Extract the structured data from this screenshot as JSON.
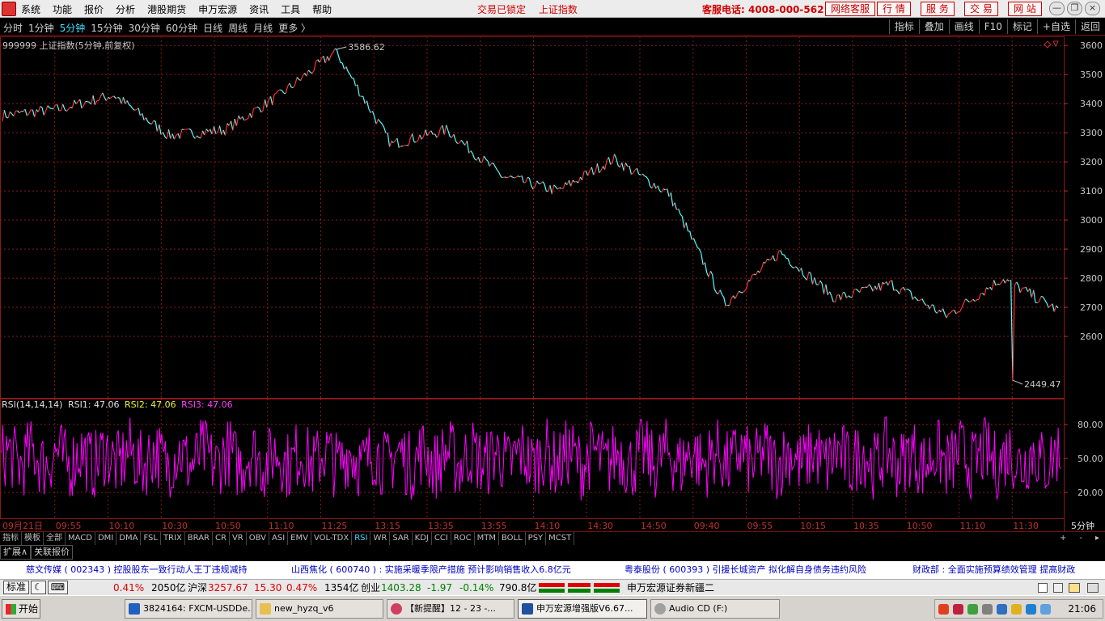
{
  "menubar": {
    "items": [
      "系统",
      "功能",
      "报价",
      "分析",
      "港股期货",
      "申万宏源",
      "资讯",
      "工具",
      "帮助"
    ],
    "status_locked": "交易已锁定",
    "status_index": "上证指数",
    "hotline": "客服电话: 4008-000-562",
    "services": [
      "网络客服",
      "行 情",
      "服 务",
      "交 易",
      "网 站"
    ],
    "window_buttons": [
      "—",
      "❐",
      "×"
    ]
  },
  "periodbar": {
    "periods": [
      "分时",
      "1分钟",
      "5分钟",
      "15分钟",
      "30分钟",
      "60分钟",
      "日线",
      "周线",
      "月线",
      "更多 〉"
    ],
    "active": "5分钟",
    "tools": [
      "指标",
      "叠加",
      "画线",
      "F10",
      "标记",
      "+自选",
      "返回"
    ]
  },
  "chart": {
    "title": "999999 上证指数(5分钟,前复权)",
    "high_label": "3586.62",
    "low_label": "2449.47",
    "y_ticks": [
      "3600",
      "3500",
      "3400",
      "3300",
      "3200",
      "3100",
      "3000",
      "2900",
      "2800",
      "2700",
      "2600"
    ],
    "x_ticks": [
      "09月21日",
      "09:55",
      "10:10",
      "10:30",
      "10:50",
      "11:10",
      "11:25",
      "13:15",
      "13:35",
      "13:55",
      "14:10",
      "14:30",
      "14:50",
      "09:40",
      "09:55",
      "10:15",
      "10:35",
      "10:50",
      "11:10",
      "11:30"
    ],
    "period_label": "5分钟",
    "colors": {
      "up": "#ff3030",
      "down": "#54ffff",
      "rsi": "#ff00ff",
      "grid": "#8b1a1a"
    }
  },
  "rsi": {
    "label": "RSI(14,14,14)",
    "rsi1": "RSI1: 47.06",
    "rsi2": "RSI2: 47.06",
    "rsi3": "RSI3: 47.06",
    "y_ticks": [
      "80.00",
      "50.00",
      "20.00"
    ]
  },
  "chart_data": {
    "type": "line",
    "title": "999999 上证指数(5分钟,前复权)",
    "xlabel": "",
    "ylabel": "",
    "x": [
      "09月21日",
      "09:55",
      "10:10",
      "10:30",
      "10:50",
      "11:10",
      "11:25",
      "13:15",
      "13:35",
      "13:55",
      "14:10",
      "14:30",
      "14:50",
      "09:40",
      "09:55",
      "10:15",
      "10:35",
      "10:50",
      "11:10",
      "11:30"
    ],
    "series": [
      {
        "values": [
          3360,
          3380,
          3430,
          3290,
          3310,
          3430,
          3580,
          3260,
          3310,
          3150,
          3100,
          3210,
          3090,
          2710,
          2890,
          2730,
          2780,
          2670,
          2800,
          2690
        ]
      }
    ],
    "ylim": [
      2400,
      3620
    ],
    "annotations": [
      {
        "text": "3586.62",
        "x": "11:25",
        "y": 3586.62
      },
      {
        "text": "2449.47",
        "x": "11:10",
        "y": 2449.47
      }
    ],
    "grid": true,
    "subchart": {
      "label": "RSI(14,14,14)",
      "ylim": [
        0,
        100
      ],
      "y_ticks": [
        80,
        50,
        20
      ],
      "current": 47.06
    }
  },
  "indicators": {
    "tabs": [
      "指标",
      "模板",
      "全部",
      "MACD",
      "DMI",
      "DMA",
      "FSL",
      "TRIX",
      "BRAR",
      "CR",
      "VR",
      "OBV",
      "ASI",
      "EMV",
      "VOL-TDX",
      "RSI",
      "WR",
      "SAR",
      "KDJ",
      "CCI",
      "ROC",
      "MTM",
      "BOLL",
      "PSY",
      "MCST"
    ],
    "active": "RSI",
    "right": [
      "+",
      "-",
      "▸"
    ]
  },
  "ext": {
    "expand": "扩展∧",
    "related": "关联报价"
  },
  "news": [
    "慈文传媒 ( 002343 ) 控股股东一致行动人王丁违规减持",
    "山西焦化 ( 600740 ) : 实施采暖季限产措施  预计影响销售收入6.8亿元",
    "粤泰股份 ( 600393 ) 引援长城资产  拟化解自身债务违约风险",
    "财政部 : 全面实施预算绩效管理  提高财政"
  ],
  "statbar": {
    "mode": "标准",
    "pct1": "0.41%",
    "amt1": "2050亿",
    "hs_label": "沪深",
    "hs_val": "3257.67",
    "hs_chg": "15.30",
    "hs_pct": "0.47%",
    "hs_amt": "1354亿",
    "cy_label": "创业",
    "cy_val": "1403.28",
    "cy_chg": "-1.97",
    "cy_pct": "-0.14%",
    "cy_amt": "790.8亿",
    "server": "申万宏源证券新疆二"
  },
  "taskbar": {
    "start": "开始",
    "tasks": [
      "3824164: FXCM-USDDe...",
      "new_hyzq_v6",
      "【新提醒】12 - 23 -...",
      "申万宏源增强版V6.67...",
      "Audio CD (F:)"
    ],
    "clock": "21:06"
  }
}
